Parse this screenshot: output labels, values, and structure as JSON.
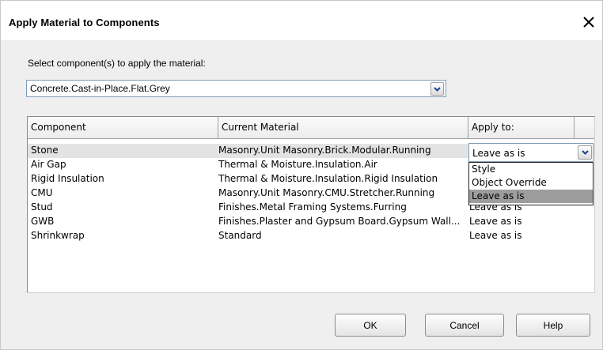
{
  "dialog": {
    "title": "Apply Material to Components",
    "close_symbol": "✕"
  },
  "prompt": "Select component(s) to apply the material:",
  "material_combo": {
    "value": "Concrete.Cast-in-Place.Flat.Grey",
    "arrow_icon": "chevron-down-icon"
  },
  "table": {
    "headers": {
      "component": "Component",
      "material": "Current Material",
      "apply": "Apply to:"
    },
    "rows": [
      {
        "component": "Stone",
        "material": "Masonry.Unit Masonry.Brick.Modular.Running",
        "apply": ""
      },
      {
        "component": "Air Gap",
        "material": "Thermal & Moisture.Insulation.Air",
        "apply": ""
      },
      {
        "component": "Rigid Insulation",
        "material": "Thermal & Moisture.Insulation.Rigid Insulation",
        "apply": ""
      },
      {
        "component": "CMU",
        "material": "Masonry.Unit Masonry.CMU.Stretcher.Running",
        "apply": ""
      },
      {
        "component": "Stud",
        "material": "Finishes.Metal Framing Systems.Furring",
        "apply": "Leave as is"
      },
      {
        "component": "GWB",
        "material": "Finishes.Plaster and Gypsum Board.Gypsum Wall...",
        "apply": "Leave as is"
      },
      {
        "component": "Shrinkwrap",
        "material": "Standard",
        "apply": "Leave as is"
      }
    ],
    "cell_combo": {
      "value": "Leave as is"
    },
    "dropdown_options": [
      "Style",
      "Object Override",
      "Leave as is"
    ]
  },
  "buttons": {
    "ok": "OK",
    "cancel": "Cancel",
    "help": "Help"
  },
  "colors": {
    "selected_row": "#e3e3e3",
    "selected_option": "#9d9d9d",
    "dialog_bg": "#efefef"
  }
}
